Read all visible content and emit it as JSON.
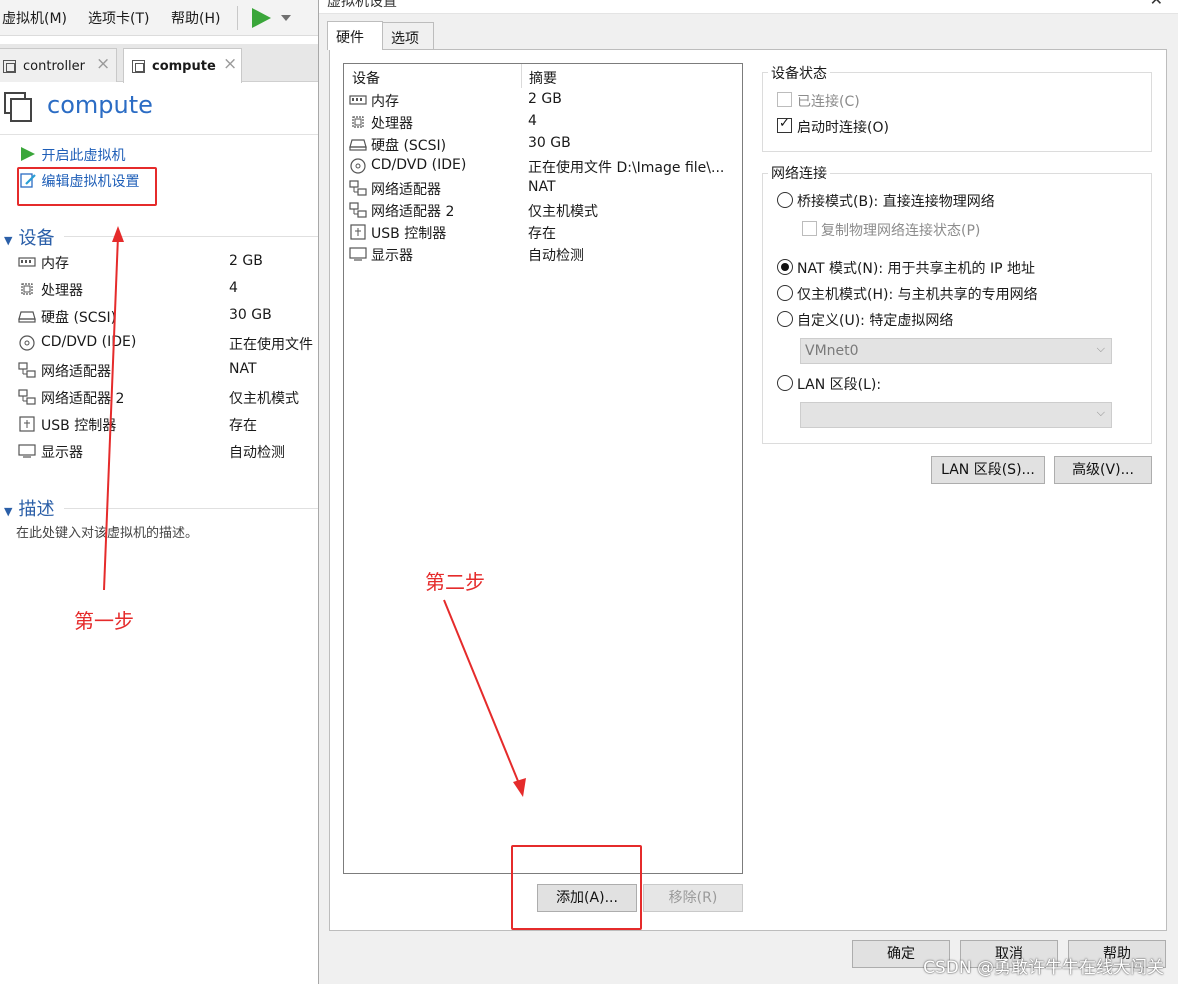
{
  "menubar": {
    "items": [
      {
        "label": "虚拟机(M)"
      },
      {
        "label": "选项卡(T)"
      },
      {
        "label": "帮助(H)"
      }
    ],
    "play_icon": "play-icon",
    "play_color": "#3aa63a"
  },
  "vm_tabs": [
    {
      "label": "controller"
    },
    {
      "label": "compute"
    }
  ],
  "vm": {
    "title": "compute",
    "commands": [
      {
        "label": "开启此虚拟机",
        "icon": "play-icon"
      },
      {
        "label": "编辑虚拟机设置",
        "icon": "edit-settings-icon"
      }
    ],
    "devices_header": "设备",
    "devices": [
      {
        "name": "内存",
        "value": "2 GB",
        "icon": "memory-icon"
      },
      {
        "name": "处理器",
        "value": "4",
        "icon": "processor-icon"
      },
      {
        "name": "硬盘 (SCSI)",
        "value": "30 GB",
        "icon": "hard-disk-icon"
      },
      {
        "name": "CD/DVD (IDE)",
        "value": "正在使用文件",
        "icon": "cd-dvd-icon"
      },
      {
        "name": "网络适配器",
        "value": "NAT",
        "icon": "network-adapter-icon"
      },
      {
        "name": "网络适配器 2",
        "value": "仅主机模式",
        "icon": "network-adapter-icon"
      },
      {
        "name": "USB 控制器",
        "value": "存在",
        "icon": "usb-icon"
      },
      {
        "name": "显示器",
        "value": "自动检测",
        "icon": "display-icon"
      }
    ],
    "description_header": "描述",
    "description_placeholder": "在此处键入对该虚拟机的描述。"
  },
  "dialog": {
    "title": "虚拟机设置",
    "tabs": [
      {
        "label": "硬件"
      },
      {
        "label": "选项"
      }
    ],
    "hardware_list": {
      "headers": {
        "device": "设备",
        "summary": "摘要"
      },
      "rows": [
        {
          "name": "内存",
          "summary": "2 GB",
          "icon": "memory-icon"
        },
        {
          "name": "处理器",
          "summary": "4",
          "icon": "processor-icon"
        },
        {
          "name": "硬盘 (SCSI)",
          "summary": "30 GB",
          "icon": "hard-disk-icon"
        },
        {
          "name": "CD/DVD (IDE)",
          "summary": "正在使用文件 D:\\Image file\\...",
          "icon": "cd-dvd-icon"
        },
        {
          "name": "网络适配器",
          "summary": "NAT",
          "icon": "network-adapter-icon"
        },
        {
          "name": "网络适配器 2",
          "summary": "仅主机模式",
          "icon": "network-adapter-icon"
        },
        {
          "name": "USB 控制器",
          "summary": "存在",
          "icon": "usb-icon"
        },
        {
          "name": "显示器",
          "summary": "自动检测",
          "icon": "display-icon"
        }
      ]
    },
    "add_button": "添加(A)...",
    "remove_button": "移除(R)",
    "device_status": {
      "title": "设备状态",
      "connected": {
        "label": "已连接(C)",
        "checked": false,
        "enabled": false
      },
      "connect_at_power_on": {
        "label": "启动时连接(O)",
        "checked": true,
        "enabled": true
      }
    },
    "network_connection": {
      "title": "网络连接",
      "bridged": {
        "label": "桥接模式(B): 直接连接物理网络",
        "checked": false
      },
      "replicate": {
        "label": "复制物理网络连接状态(P)",
        "checked": false,
        "enabled": false
      },
      "nat": {
        "label": "NAT 模式(N): 用于共享主机的 IP 地址",
        "checked": true
      },
      "host_only": {
        "label": "仅主机模式(H): 与主机共享的专用网络",
        "checked": false
      },
      "custom": {
        "label": "自定义(U): 特定虚拟网络",
        "checked": false
      },
      "custom_select_value": "VMnet0",
      "lan_segment": {
        "label": "LAN 区段(L):",
        "checked": false
      },
      "lan_segment_select_value": ""
    },
    "lan_segments_button": "LAN 区段(S)...",
    "advanced_button": "高级(V)...",
    "ok_button": "确定",
    "cancel_button": "取消",
    "help_button": "帮助"
  },
  "annotations": {
    "step1": "第一步",
    "step2": "第二步",
    "color": "#e52b2b"
  },
  "watermark": "CSDN @勇敢许牛牛在线大闯关"
}
